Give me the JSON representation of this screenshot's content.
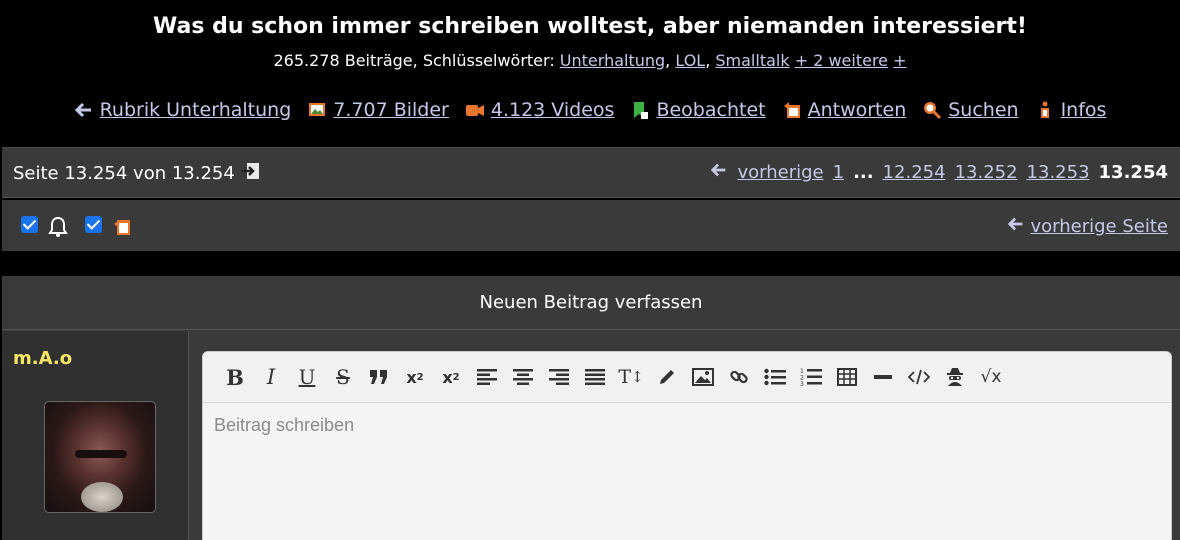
{
  "header": {
    "title": "Was du schon immer schreiben wolltest, aber niemanden interessiert!",
    "posts_count": "265.278 Beiträge, Schlüsselwörter: ",
    "tags": [
      "Unterhaltung",
      "LOL",
      "Smalltalk"
    ],
    "more_tags": "+ 2 weitere",
    "add_tag": "+"
  },
  "nav": {
    "back": "Rubrik Unterhaltung",
    "images": "7.707 Bilder",
    "videos": "4.123 Videos",
    "watched": "Beobachtet",
    "replies": "Antworten",
    "search": "Suchen",
    "info": "Infos"
  },
  "pagination": {
    "page_info": "Seite 13.254 von 13.254",
    "prev": "vorherige",
    "pages": [
      "1",
      "...",
      "12.254",
      "13.252",
      "13.253"
    ],
    "current": "13.254"
  },
  "options": {
    "notify_checked": true,
    "reply_checked": true,
    "prev_page": "vorherige Seite"
  },
  "compose": {
    "title": "Neuen Beitrag verfassen",
    "author": "m.A.o",
    "placeholder": "Beitrag schreiben",
    "toolbar": [
      "bold",
      "italic",
      "underline",
      "strikethrough",
      "quote",
      "subscript",
      "superscript",
      "align-left",
      "align-center",
      "align-right",
      "justify",
      "font-size",
      "pen",
      "image",
      "link",
      "bullet-list",
      "numbered-list",
      "table",
      "horizontal-rule",
      "code",
      "spoiler",
      "formula"
    ]
  },
  "colors": {
    "link": "#c6c8e8",
    "bar_bg": "#3a3a3a",
    "author": "#f5e663"
  }
}
